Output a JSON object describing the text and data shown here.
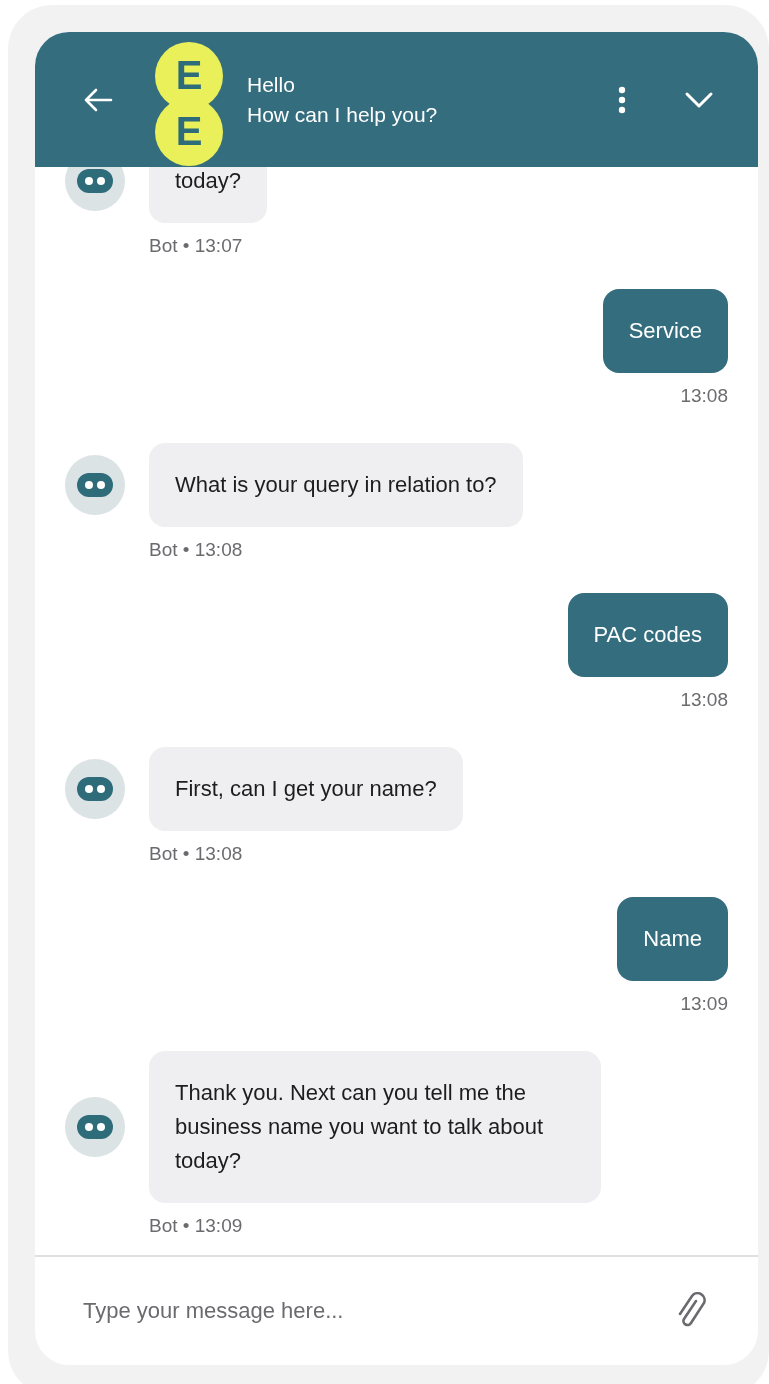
{
  "header": {
    "logo_letters": [
      "E",
      "E"
    ],
    "title": "Hello",
    "subtitle": "How can I help you?"
  },
  "messages": [
    {
      "kind": "bot",
      "text": "today?",
      "meta": "Bot • 13:07"
    },
    {
      "kind": "user",
      "text": "Service",
      "meta": "13:08"
    },
    {
      "kind": "bot",
      "text": "What is your query in relation to?",
      "meta": "Bot • 13:08"
    },
    {
      "kind": "user",
      "text": "PAC codes",
      "meta": "13:08"
    },
    {
      "kind": "bot",
      "text": "First, can I get your name?",
      "meta": "Bot • 13:08"
    },
    {
      "kind": "user",
      "text": "Name",
      "meta": "13:09"
    },
    {
      "kind": "bot",
      "text": "Thank you. Next can you tell me the business name you want to talk about today?",
      "meta": "Bot • 13:09"
    }
  ],
  "composer": {
    "placeholder": "Type your message here..."
  }
}
